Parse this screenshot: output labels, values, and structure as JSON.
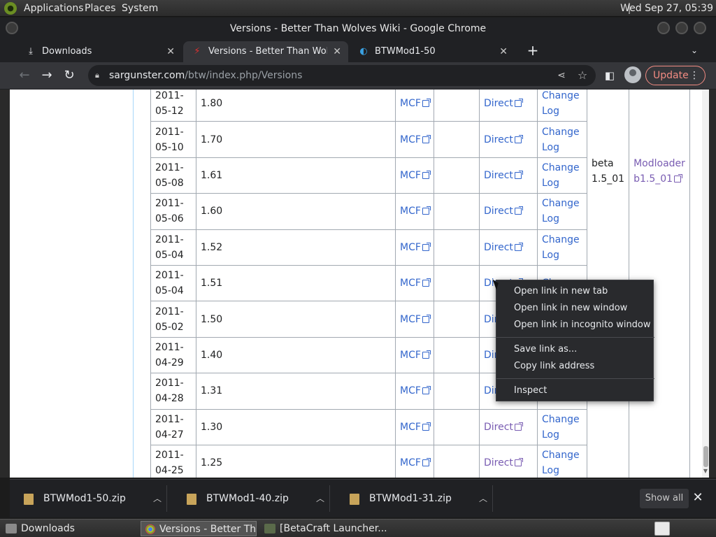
{
  "topbar": {
    "menu": [
      "Applications",
      "Places",
      "System"
    ],
    "clock": "Wed Sep 27, 05:39"
  },
  "window": {
    "title": "Versions - Better Than Wolves Wiki - Google Chrome"
  },
  "tabs": [
    {
      "label": "Downloads",
      "icon": "download-icon"
    },
    {
      "label": "Versions - Better Than Wolves",
      "icon": "btw-icon"
    },
    {
      "label": "BTWMod1-50",
      "icon": "edge-icon"
    }
  ],
  "toolbar": {
    "url_host": "sargunster.com",
    "url_path": "/btw/index.php/Versions",
    "update_label": "Update"
  },
  "table": {
    "rows": [
      {
        "date": "2011-\n05-12",
        "version": "1.80",
        "mcf": "MCF",
        "direct": "Direct",
        "changelog": "Change Log"
      },
      {
        "date": "2011-\n05-10",
        "version": "1.70",
        "mcf": "MCF",
        "direct": "Direct",
        "changelog": "Change Log"
      },
      {
        "date": "2011-\n05-08",
        "version": "1.61",
        "mcf": "MCF",
        "direct": "Direct",
        "changelog": "Change Log"
      },
      {
        "date": "2011-\n05-06",
        "version": "1.60",
        "mcf": "MCF",
        "direct": "Direct",
        "changelog": "Change Log"
      },
      {
        "date": "2011-\n05-04",
        "version": "1.52",
        "mcf": "MCF",
        "direct": "Direct",
        "changelog": "Change Log"
      },
      {
        "date": "2011-\n05-04",
        "version": "1.51",
        "mcf": "MCF",
        "direct": "Direct",
        "changelog": "Change"
      },
      {
        "date": "2011-\n05-02",
        "version": "1.50",
        "mcf": "MCF",
        "direct": "Dir",
        "changelog": ""
      },
      {
        "date": "2011-\n04-29",
        "version": "1.40",
        "mcf": "MCF",
        "direct": "Dir",
        "changelog": ""
      },
      {
        "date": "2011-\n04-28",
        "version": "1.31",
        "mcf": "MCF",
        "direct": "Dir",
        "changelog": ""
      },
      {
        "date": "2011-\n04-27",
        "version": "1.30",
        "mcf": "MCF",
        "direct": "Direct",
        "changelog": "Change Log"
      },
      {
        "date": "2011-\n04-25",
        "version": "1.25",
        "mcf": "MCF",
        "direct": "Direct",
        "changelog": "Change Log"
      }
    ],
    "minecraft_version": "beta\n1.5_01",
    "modloader": "Modloader\nb1.5_01"
  },
  "context_menu": {
    "items": [
      "Open link in new tab",
      "Open link in new window",
      "Open link in incognito window",
      "Save link as...",
      "Copy link address",
      "Inspect"
    ]
  },
  "downloads": {
    "items": [
      "BTWMod1-50.zip",
      "BTWMod1-40.zip",
      "BTWMod1-31.zip"
    ],
    "show_all": "Show all"
  },
  "taskbar": {
    "items": [
      "Downloads",
      "Versions - Better Th...",
      "[BetaCraft Launcher..."
    ]
  }
}
